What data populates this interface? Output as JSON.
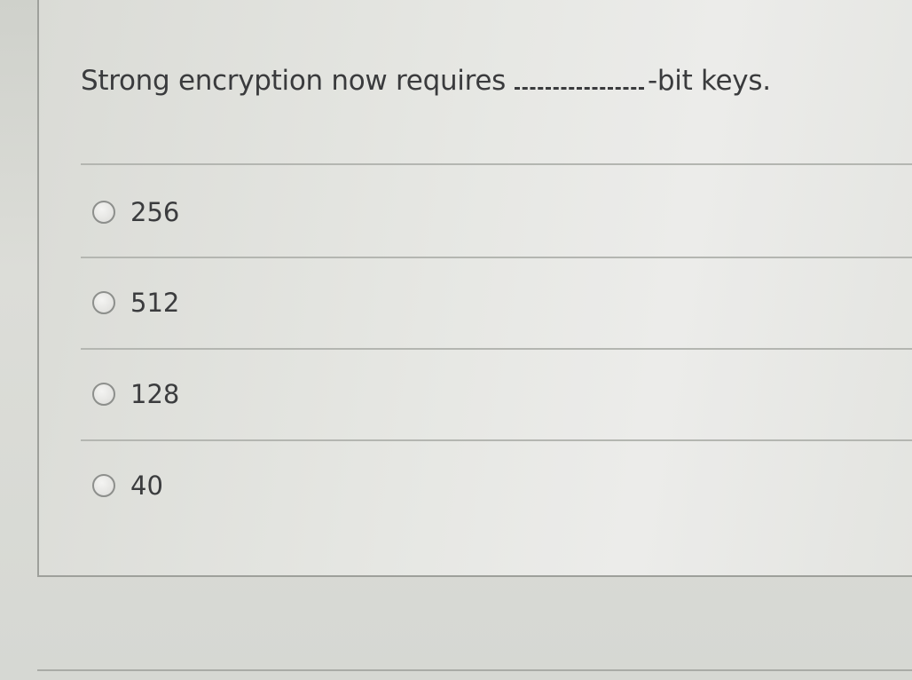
{
  "question": {
    "prefix": "Strong encryption now requires",
    "suffix": "-bit keys."
  },
  "options": [
    {
      "label": "256",
      "selected": false
    },
    {
      "label": "512",
      "selected": false
    },
    {
      "label": "128",
      "selected": false
    },
    {
      "label": "40",
      "selected": false
    }
  ]
}
